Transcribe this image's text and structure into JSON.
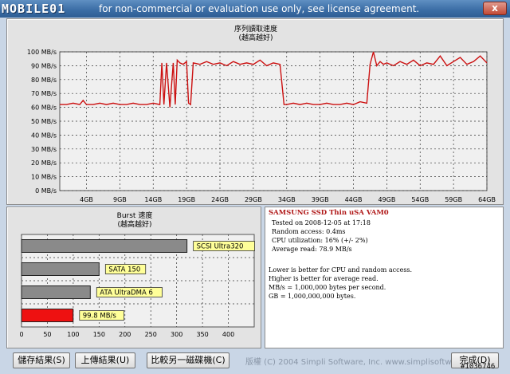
{
  "window": {
    "logo_text": "MOBILE01",
    "title": "for non-commercial or evaluation use only, see license agreement.",
    "close_label": "x"
  },
  "read_chart": {
    "title_line1": "序列讀取速度",
    "title_line2": "(越高越好)"
  },
  "burst_chart": {
    "title_line1": "Burst 速度",
    "title_line2": "(越高越好)"
  },
  "chart_data": [
    {
      "type": "line",
      "title": "序列讀取速度",
      "subtitle": "(越高越好)",
      "xlabel": "",
      "ylabel": "",
      "ylim": [
        0,
        100
      ],
      "y_ticks": [
        "0 MB/s",
        "10 MB/s",
        "20 MB/s",
        "30 MB/s",
        "40 MB/s",
        "50 MB/s",
        "60 MB/s",
        "70 MB/s",
        "80 MB/s",
        "90 MB/s",
        "100 MB/s"
      ],
      "x_ticks": [
        "4GB",
        "9GB",
        "14GB",
        "19GB",
        "24GB",
        "29GB",
        "34GB",
        "39GB",
        "44GB",
        "49GB",
        "54GB",
        "59GB",
        "64GB"
      ],
      "xlim": [
        0,
        64
      ],
      "grid": true,
      "color": "#cc1111",
      "series": [
        {
          "x": [
            0,
            1,
            2,
            3,
            3.5,
            4,
            5,
            6,
            7,
            8,
            9,
            10,
            11,
            12,
            13,
            14,
            15,
            15.3,
            15.6,
            16,
            16.5,
            17,
            17.3,
            17.6,
            18,
            18.5,
            19,
            19.3,
            19.6,
            20,
            21,
            22,
            23,
            24,
            25,
            26,
            27,
            28,
            29,
            30,
            31,
            32,
            33,
            33.6,
            34,
            35,
            36,
            37,
            38,
            39,
            40,
            41,
            42,
            43,
            44,
            45,
            46,
            46.5,
            47,
            47.5,
            48,
            48.5,
            49,
            50,
            51,
            52,
            53,
            54,
            55,
            56,
            57,
            58,
            59,
            60,
            61,
            62,
            63,
            64
          ],
          "y": [
            62,
            62,
            63,
            62,
            65,
            62,
            62,
            63,
            62,
            63,
            62,
            62,
            63,
            62,
            62,
            63,
            62,
            92,
            62,
            92,
            60,
            92,
            62,
            94,
            92,
            91,
            93,
            63,
            62,
            92,
            91,
            93,
            91,
            92,
            90,
            93,
            91,
            92,
            91,
            94,
            90,
            92,
            91,
            62,
            62,
            63,
            62,
            63,
            62,
            62,
            63,
            62,
            62,
            63,
            62,
            64,
            63,
            91,
            100,
            90,
            93,
            91,
            92,
            90,
            93,
            91,
            94,
            90,
            92,
            91,
            97,
            90,
            93,
            96,
            91,
            93,
            97,
            92
          ]
        }
      ]
    },
    {
      "type": "bar",
      "orientation": "horizontal",
      "title": "Burst 速度",
      "subtitle": "(越高越好)",
      "xlim": [
        0,
        450
      ],
      "x_ticks": [
        "0",
        "50",
        "100",
        "150",
        "200",
        "250",
        "300",
        "350",
        "400"
      ],
      "grid": true,
      "categories": [
        "SCSI Ultra320",
        "SATA 150",
        "ATA UltraDMA 6",
        "99.8 MB/s"
      ],
      "values": [
        320,
        150,
        133,
        99.8
      ],
      "colors": [
        "#8a8a8a",
        "#8a8a8a",
        "#8a8a8a",
        "#ee1111"
      ]
    }
  ],
  "info": {
    "drive_name": "SAMSUNG SSD Thin uSA VAM0",
    "tested_on": "Tested on 2008-12-05 at 17:18",
    "random_access": "Random access: 0.4ms",
    "cpu_utilization": "CPU utilization: 16% (+/- 2%)",
    "average_read": "Average read: 78.9 MB/s",
    "note1": "Lower is better for CPU and random access.",
    "note2": "Higher is better for average read.",
    "note3": "MB/s = 1,000,000 bytes per second.",
    "note4": "GB = 1,000,000,000 bytes."
  },
  "footer": {
    "save_label": "儲存結果(S)",
    "upload_label": "上傳結果(U)",
    "compare_label": "比較另一磁碟機(C)",
    "copyright": "版權 (C) 2004 Simpli Software, Inc. www.simplisoftware.com",
    "done_label": "完成(D)",
    "watermark": "#1036746"
  }
}
